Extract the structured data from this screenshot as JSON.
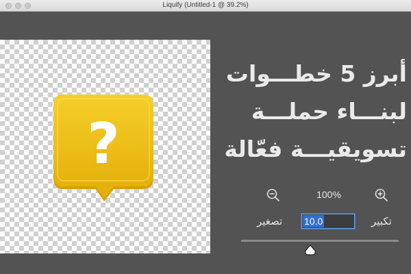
{
  "window": {
    "title": "Liquify (Untitled-1 @ 39.2%)"
  },
  "canvas": {
    "image": {
      "symbol": "?",
      "color": "#f2c00f",
      "icon": "question-speech-bubble-icon"
    }
  },
  "headline": {
    "lines": [
      "أبرز 5 خطـــوات",
      "لبنـــاء حملـــة",
      "تسويقيـــة فعّالة"
    ]
  },
  "zoom": {
    "level": "100%",
    "zoom_out_icon": "zoom-out-icon",
    "zoom_in_icon": "zoom-in-icon"
  },
  "brush": {
    "zoom_out_label": "تصغير",
    "zoom_in_label": "تكبير",
    "size_value": "10.0",
    "slider_fraction": 0.4
  },
  "colors": {
    "accent": "#2f6fd6",
    "background": "#535353"
  }
}
